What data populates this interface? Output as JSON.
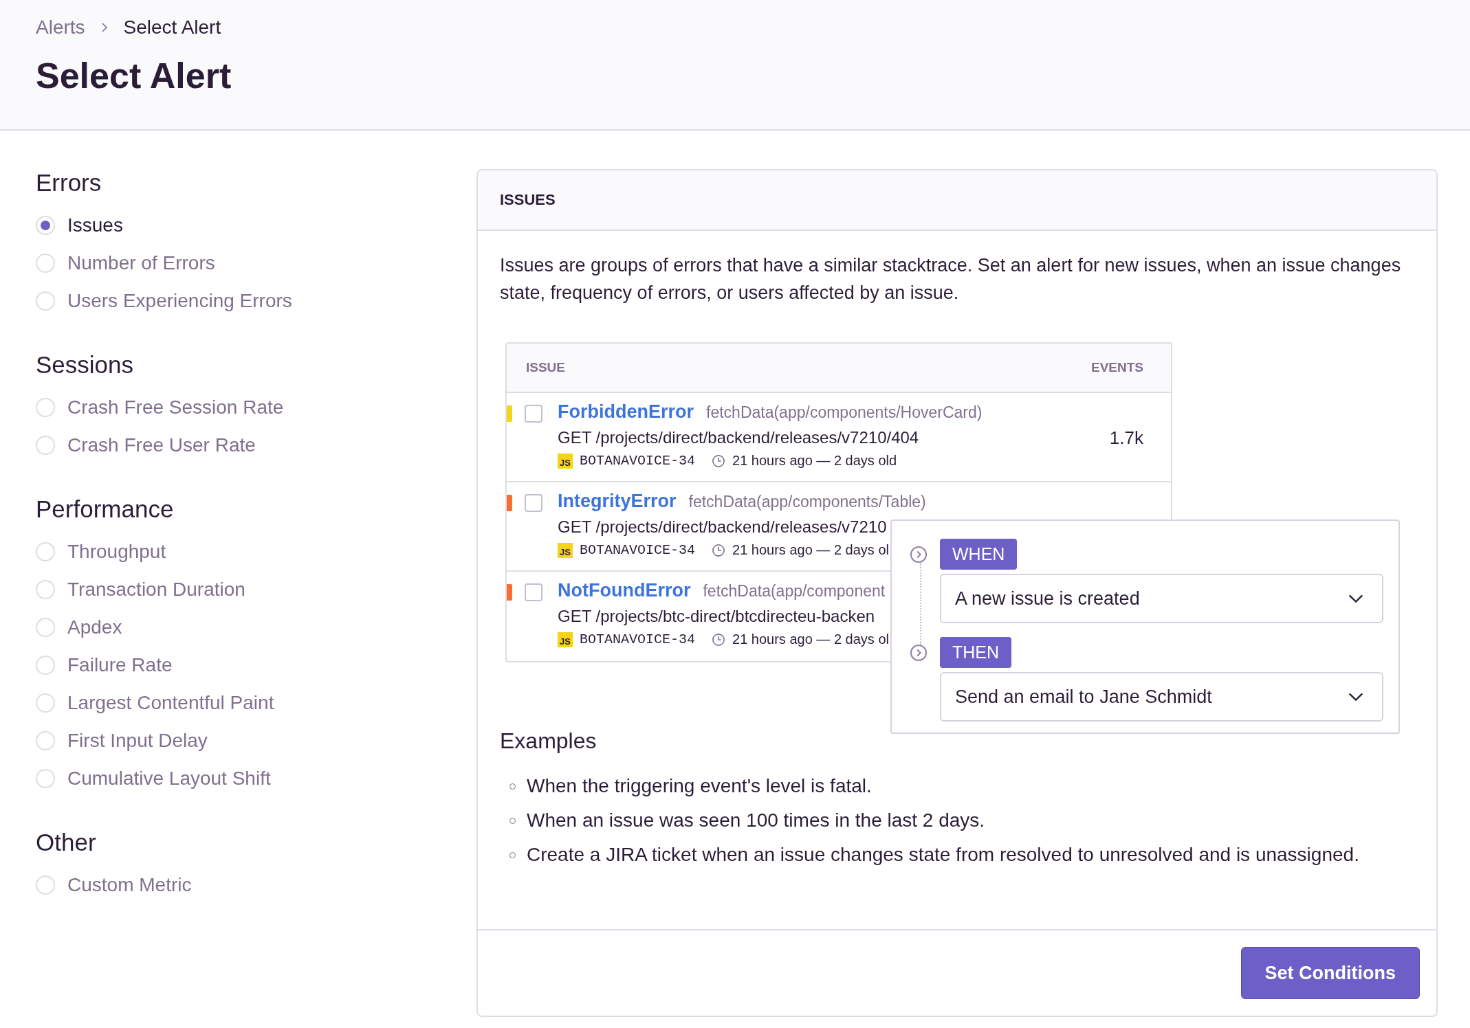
{
  "breadcrumbs": [
    {
      "label": "Alerts",
      "current": false
    },
    {
      "label": "Select Alert",
      "current": true
    }
  ],
  "title": "Select Alert",
  "sidebar": [
    {
      "heading": "Errors",
      "options": [
        {
          "label": "Issues",
          "selected": true
        },
        {
          "label": "Number of Errors",
          "selected": false
        },
        {
          "label": "Users Experiencing Errors",
          "selected": false
        }
      ]
    },
    {
      "heading": "Sessions",
      "options": [
        {
          "label": "Crash Free Session Rate",
          "selected": false
        },
        {
          "label": "Crash Free User Rate",
          "selected": false
        }
      ]
    },
    {
      "heading": "Performance",
      "options": [
        {
          "label": "Throughput",
          "selected": false
        },
        {
          "label": "Transaction Duration",
          "selected": false
        },
        {
          "label": "Apdex",
          "selected": false
        },
        {
          "label": "Failure Rate",
          "selected": false
        },
        {
          "label": "Largest Contentful Paint",
          "selected": false
        },
        {
          "label": "First Input Delay",
          "selected": false
        },
        {
          "label": "Cumulative Layout Shift",
          "selected": false
        }
      ]
    },
    {
      "heading": "Other",
      "options": [
        {
          "label": "Custom Metric",
          "selected": false
        }
      ]
    }
  ],
  "panel": {
    "title": "ISSUES",
    "description": "Issues are groups of errors that have a similar stacktrace. Set an alert for new issues, when an issue changes state, frequency of errors, or users affected by an issue.",
    "issues_table": {
      "columns": [
        "ISSUE",
        "EVENTS"
      ],
      "rows": [
        {
          "color": "#f5d31b",
          "checked": false,
          "title": "ForbiddenError",
          "culprit": "fetchData(app/components/HoverCard)",
          "message": "GET /projects/direct/backend/releases/v7210/404",
          "platform": "JS",
          "short_id": "BOTANAVOICE-34",
          "age": "21 hours ago — 2 days old",
          "events": "1.7k"
        },
        {
          "color": "#f86e31",
          "checked": false,
          "title": "IntegrityError",
          "culprit": "fetchData(app/components/Table)",
          "message": "GET /projects/direct/backend/releases/v7210",
          "platform": "JS",
          "short_id": "BOTANAVOICE-34",
          "age": "21 hours ago — 2 days ol"
        },
        {
          "color": "#f86e31",
          "checked": false,
          "title": "NotFoundError",
          "culprit": "fetchData(app/component",
          "message": "GET /projects/btc-direct/btcdirecteu-backen",
          "platform": "JS",
          "short_id": "BOTANAVOICE-34",
          "age": "21 hours ago — 2 days ol"
        }
      ]
    },
    "rule": [
      {
        "tag": "WHEN",
        "value": "A new issue is created"
      },
      {
        "tag": "THEN",
        "value": "Send an email to Jane Schmidt"
      }
    ],
    "examples_heading": "Examples",
    "examples": [
      "When the triggering event's level is fatal.",
      "When an issue was seen 100 times in the last 2 days.",
      "Create a JIRA ticket when an issue changes state from resolved to unresolved and is unassigned."
    ],
    "button": "Set Conditions"
  }
}
